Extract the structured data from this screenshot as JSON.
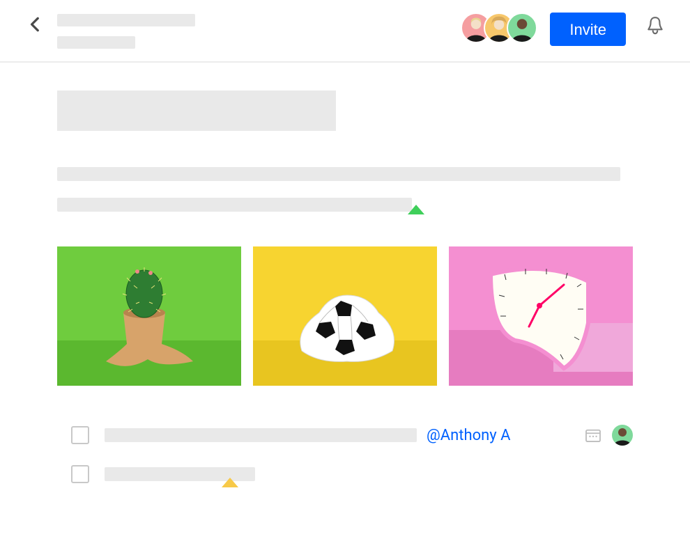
{
  "header": {
    "invite_label": "Invite",
    "avatars": [
      {
        "bg": "#f59ea0"
      },
      {
        "bg": "#f7c76b"
      },
      {
        "bg": "#7fd99b"
      }
    ]
  },
  "tasks": {
    "mention": "@Anthony A",
    "assignee_bg": "#7fd99b"
  },
  "gallery": {
    "tile1_alt": "melting-cactus-pot",
    "tile2_alt": "melting-soccer-ball",
    "tile3_alt": "melting-clock"
  }
}
